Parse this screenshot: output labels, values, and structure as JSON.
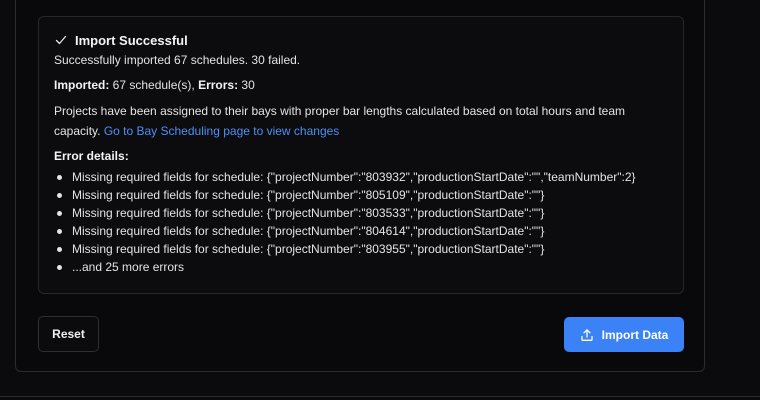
{
  "alert": {
    "icon": "check-icon",
    "title": "Import Successful",
    "summary": "Successfully imported 67 schedules. 30 failed.",
    "imported_label": "Imported:",
    "imported_value": " 67 schedule(s), ",
    "errors_label": "Errors:",
    "errors_value": " 30",
    "info_text": "Projects have been assigned to their bays with proper bar lengths calculated based on total hours and team capacity. ",
    "link_text": "Go to Bay Scheduling page to view changes",
    "errors_heading": "Error details:",
    "errors": [
      "Missing required fields for schedule: {\"projectNumber\":\"803932\",\"productionStartDate\":\"\",\"teamNumber\":2}",
      "Missing required fields for schedule: {\"projectNumber\":\"805109\",\"productionStartDate\":\"\"}",
      "Missing required fields for schedule: {\"projectNumber\":\"803533\",\"productionStartDate\":\"\"}",
      "Missing required fields for schedule: {\"projectNumber\":\"804614\",\"productionStartDate\":\"\"}",
      "Missing required fields for schedule: {\"projectNumber\":\"803955\",\"productionStartDate\":\"\"}",
      "...and 25 more errors"
    ]
  },
  "actions": {
    "reset_label": "Reset",
    "import_label": "Import Data",
    "import_icon": "upload-icon"
  },
  "colors": {
    "accent": "#3b82f6",
    "link": "#4d8ff5",
    "background": "#0b0b0d"
  }
}
